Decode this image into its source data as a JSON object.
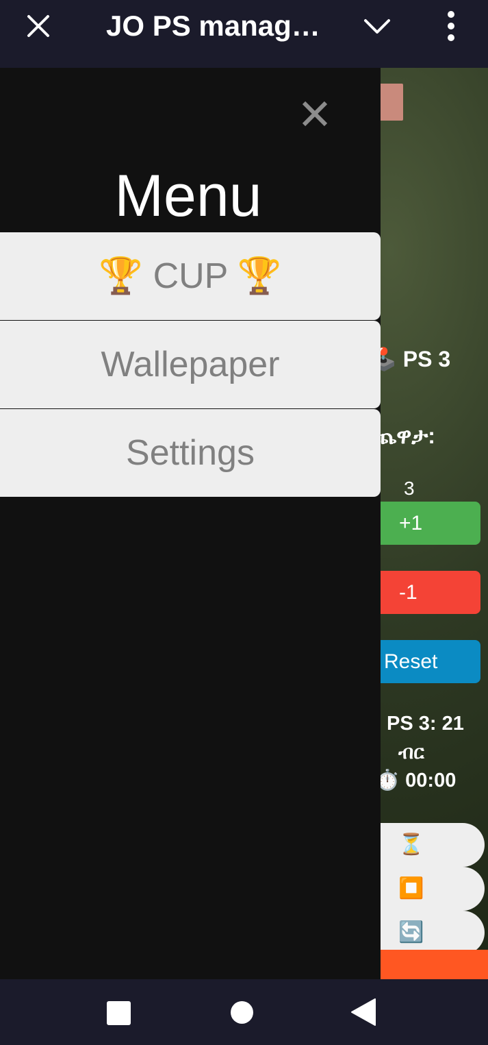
{
  "app": {
    "title": "JO PS manag…"
  },
  "background": {
    "ps_label": "🕹️ PS 3",
    "amharic_label": "ጨዋታ:",
    "count": "3",
    "plus_button": "+1",
    "minus_button": "-1",
    "reset_button": "Reset",
    "price": "PS 3: 21",
    "currency": "ብር",
    "timer": "⏱️ 00:00",
    "hourglass_button": "⏳",
    "stop_button": "⏹️",
    "refresh_button": "🔄"
  },
  "menu": {
    "title": "Menu",
    "items": [
      {
        "label": "🏆 CUP 🏆"
      },
      {
        "label": "Wallepaper"
      },
      {
        "label": "Settings"
      }
    ]
  },
  "icons": {
    "close": "close-icon",
    "chevron": "chevron-down-icon",
    "more": "more-vert-icon",
    "gamepad": "gamepad-icon",
    "nav_recents": "nav-recents-icon",
    "nav_home": "nav-home-icon",
    "nav_back": "nav-back-icon"
  },
  "colors": {
    "topbar": "#1b1b2b",
    "menu_bg": "#111111",
    "menu_item_bg": "#eeeeee",
    "menu_item_text": "#808080",
    "plus": "#4caf50",
    "minus": "#f44336",
    "reset": "#0b8bc3",
    "accent_orange": "#ff5722"
  }
}
